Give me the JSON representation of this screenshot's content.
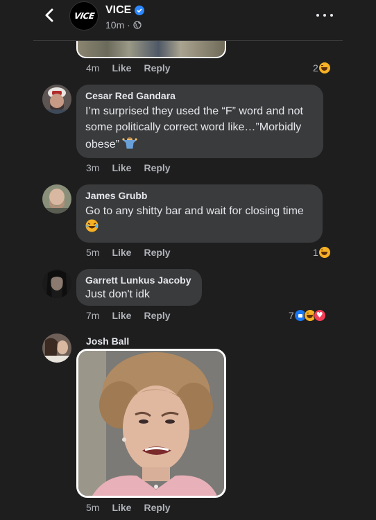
{
  "header": {
    "page_name": "VICE",
    "logo_text": "VICE",
    "time": "10m ·",
    "back_icon": "chevron-left-icon",
    "more_icon": "more-dots-icon"
  },
  "colors": {
    "background": "#1e1e1f",
    "bubble": "#3a3b3c",
    "text_primary": "#e4e6eb",
    "text_secondary": "#b0b3b8",
    "verified": "#2d88ff",
    "haha": "#f7b125",
    "like": "#1877f2",
    "love": "#f33e58"
  },
  "comments": [
    {
      "author": "",
      "text": "",
      "time": "4m",
      "like_label": "Like",
      "reply_label": "Reply",
      "reaction_count": "2",
      "reactions": [
        "haha"
      ]
    },
    {
      "author": "Cesar Red Gandara",
      "text": "I’m surprised they used the “F” word and not some politically correct word like…”Morbidly obese”",
      "emoji": "person-shrugging",
      "time": "3m",
      "like_label": "Like",
      "reply_label": "Reply"
    },
    {
      "author": "James Grubb",
      "text": "Go to any shitty bar and wait for closing time",
      "emoji": "tears-of-joy",
      "time": "5m",
      "like_label": "Like",
      "reply_label": "Reply",
      "reaction_count": "1",
      "reactions": [
        "haha"
      ]
    },
    {
      "author": "Garrett Lunkus Jacoby",
      "text": "Just don't idk",
      "time": "7m",
      "like_label": "Like",
      "reply_label": "Reply",
      "reaction_count": "7",
      "reactions": [
        "like",
        "haha",
        "love"
      ]
    },
    {
      "author": "Josh Ball",
      "text": "",
      "attachment": "gif",
      "time": "5m",
      "like_label": "Like",
      "reply_label": "Reply"
    }
  ]
}
